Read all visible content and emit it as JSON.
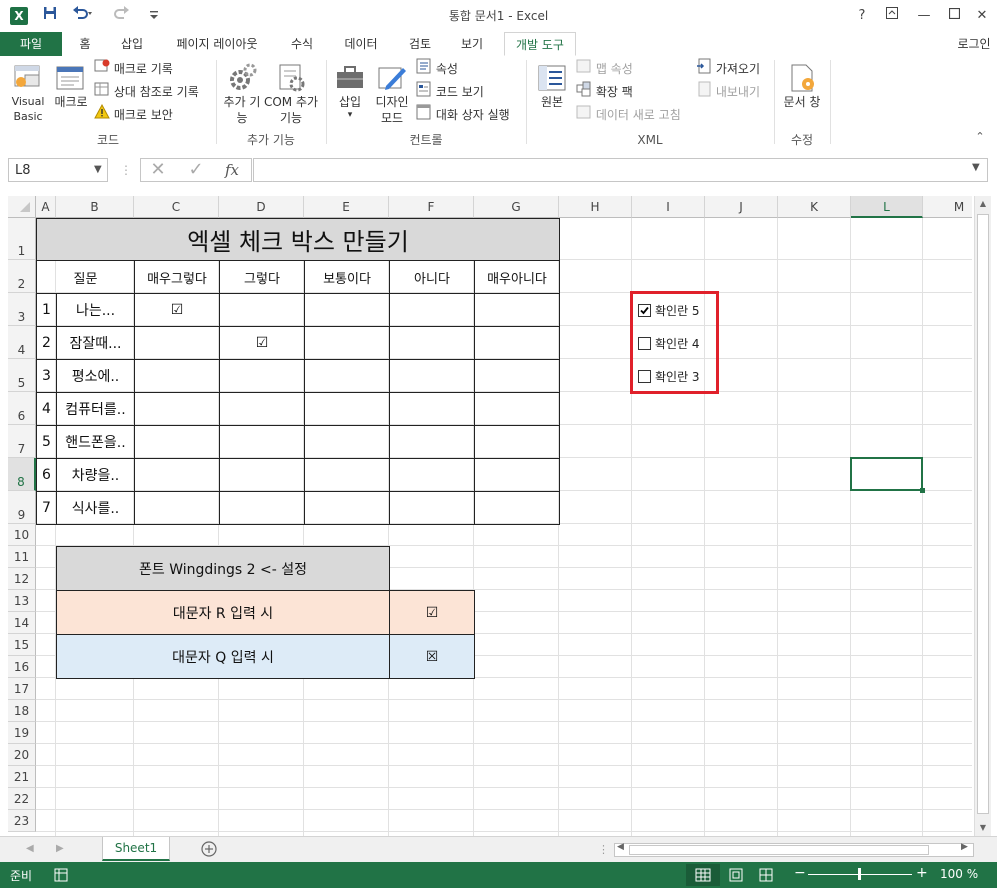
{
  "window": {
    "title": "통합 문서1 - Excel",
    "login": "로그인"
  },
  "quick_access": {
    "app_icon": "excel-icon",
    "save_icon": "save-icon",
    "undo_icon": "undo-icon",
    "redo_icon": "redo-icon"
  },
  "tabs": [
    "파일",
    "홈",
    "삽입",
    "페이지 레이아웃",
    "수식",
    "데이터",
    "검토",
    "보기",
    "개발 도구"
  ],
  "ribbon": {
    "code": {
      "visual_basic": "Visual Basic",
      "macro": "매크로",
      "record": "매크로 기록",
      "relative": "상대 참조로 기록",
      "security": "매크로 보안",
      "group": "코드"
    },
    "addins": {
      "addins": "추가 기능",
      "com": "COM 추가 기능",
      "group": "추가 기능"
    },
    "controls": {
      "insert": "삽입",
      "design": "디자인 모드",
      "properties": "속성",
      "view_code": "코드 보기",
      "dialog": "대화 상자 실행",
      "group": "컨트롤"
    },
    "xml": {
      "source": "원본",
      "map_props": "맵 속성",
      "expansion": "확장 팩",
      "refresh": "데이터 새로 고침",
      "import": "가져오기",
      "export": "내보내기",
      "group": "XML"
    },
    "modify": {
      "doc_panel": "문서 창",
      "group": "수정"
    }
  },
  "formula_bar": {
    "name_box": "L8",
    "formula": "",
    "fx": "fx"
  },
  "columns": [
    "A",
    "B",
    "C",
    "D",
    "E",
    "F",
    "G",
    "H",
    "I",
    "J",
    "K",
    "L",
    "M"
  ],
  "rows": [
    "1",
    "2",
    "3",
    "4",
    "5",
    "6",
    "7",
    "8",
    "9",
    "10",
    "11",
    "12",
    "13",
    "14",
    "15",
    "16",
    "17",
    "18",
    "19",
    "20",
    "21",
    "22",
    "23"
  ],
  "selected_cell": "L8",
  "sheet": {
    "title": "엑셀 체크 박스 만들기",
    "headers": [
      "질문",
      "매우그렇다",
      "그렇다",
      "보통이다",
      "아니다",
      "매우아니다"
    ],
    "rows": [
      {
        "no": "1",
        "q": "나는...",
        "checks": [
          "☑",
          "",
          "",
          "",
          ""
        ]
      },
      {
        "no": "2",
        "q": "잠잘때...",
        "checks": [
          "",
          "☑",
          "",
          "",
          ""
        ]
      },
      {
        "no": "3",
        "q": "평소에..",
        "checks": [
          "",
          "",
          "",
          "",
          ""
        ]
      },
      {
        "no": "4",
        "q": "컴퓨터를..",
        "checks": [
          "",
          "",
          "",
          "",
          ""
        ]
      },
      {
        "no": "5",
        "q": "핸드폰을..",
        "checks": [
          "",
          "",
          "",
          "",
          ""
        ]
      },
      {
        "no": "6",
        "q": "차량을..",
        "checks": [
          "",
          "",
          "",
          "",
          ""
        ]
      },
      {
        "no": "7",
        "q": "식사를..",
        "checks": [
          "",
          "",
          "",
          "",
          ""
        ]
      }
    ],
    "legend": {
      "font_note": "폰트 Wingdings 2 <- 설정",
      "r_label": "대문자 R 입력 시",
      "r_symbol": "☑",
      "q_label": "대문자 Q 입력 시",
      "q_symbol": "☒"
    },
    "checkboxes": [
      {
        "label": "확인란 5",
        "checked": true
      },
      {
        "label": "확인란 4",
        "checked": false
      },
      {
        "label": "확인란 3",
        "checked": false
      }
    ]
  },
  "colors": {
    "excel_green": "#217346",
    "header_gray": "#d9d9d9",
    "peach": "#fce4d6",
    "light_blue": "#ddebf7",
    "highlight_red": "#e0202a"
  },
  "sheet_tabs": {
    "active": "Sheet1",
    "add_icon": "plus-circle-icon"
  },
  "status_bar": {
    "ready": "준비",
    "zoom": "100 %"
  }
}
